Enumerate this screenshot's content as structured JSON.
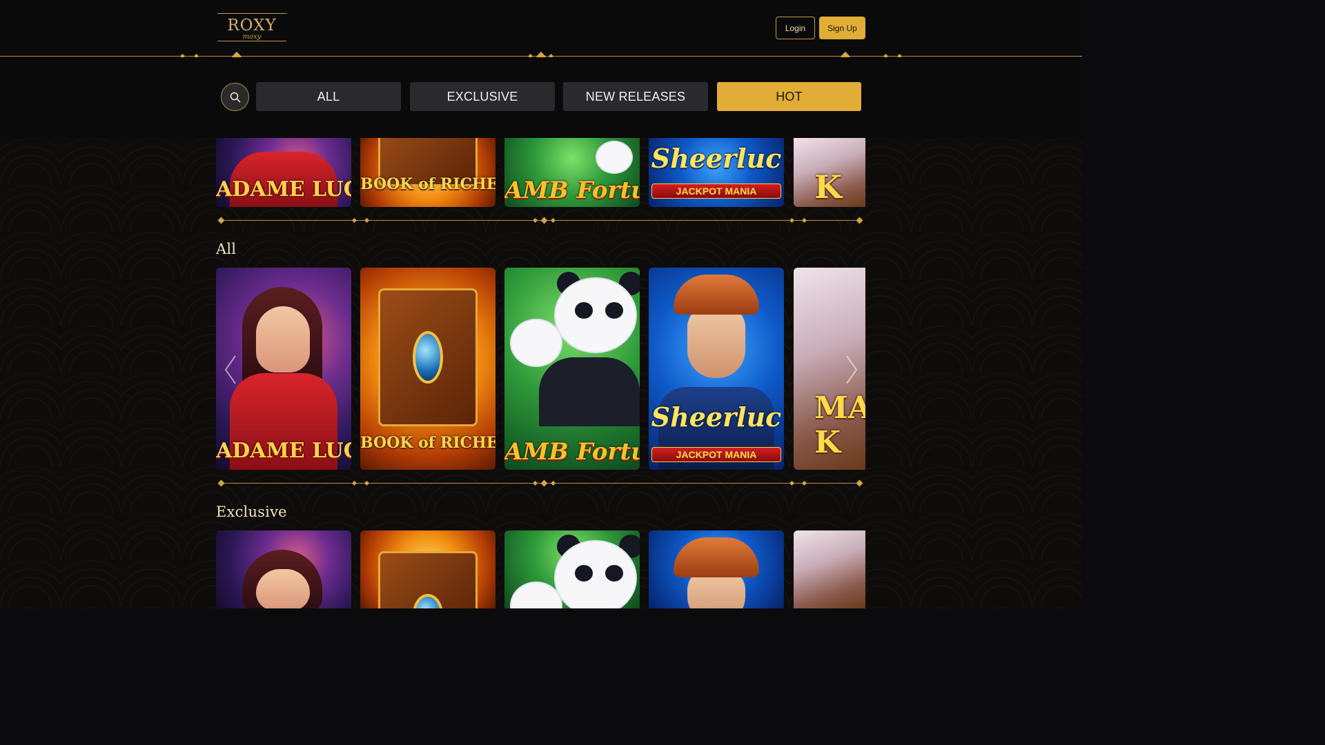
{
  "brand": {
    "logo_text": "ROXY",
    "logo_subtext": "moxy"
  },
  "header": {
    "login_label": "Login",
    "signup_label": "Sign Up"
  },
  "filters": {
    "search_icon": "search-icon",
    "tabs": [
      {
        "label": "ALL",
        "active": false
      },
      {
        "label": "EXCLUSIVE",
        "active": false
      },
      {
        "label": "NEW RELEASES",
        "active": false
      },
      {
        "label": "HOT",
        "active": true
      }
    ]
  },
  "sections": [
    {
      "title": "",
      "games": [
        {
          "caption": "ADAME LUC"
        },
        {
          "caption": "BOOK of RICHE"
        },
        {
          "caption": "AMB Fortune"
        },
        {
          "caption": "Sheerluc",
          "badge": "JACKPOT MANIA"
        },
        {
          "caption": "K"
        }
      ]
    },
    {
      "title": "All",
      "games": [
        {
          "caption": "ADAME LUC"
        },
        {
          "caption": "BOOK of RICHE"
        },
        {
          "caption": "AMB Fortune"
        },
        {
          "caption": "Sheerluc",
          "badge": "JACKPOT MANIA"
        },
        {
          "caption": "MA K"
        }
      ]
    },
    {
      "title": "Exclusive",
      "games": [
        {
          "caption": ""
        },
        {
          "caption": ""
        },
        {
          "caption": ""
        },
        {
          "caption": ""
        },
        {
          "caption": ""
        }
      ]
    }
  ],
  "colors": {
    "accent": "#e2ad36",
    "gold_line": "#b7903f",
    "background": "#0b0b0d",
    "tab_bg": "#2a2a2c"
  },
  "icons": {
    "prev": "chevron-left-icon",
    "next": "chevron-right-icon"
  }
}
